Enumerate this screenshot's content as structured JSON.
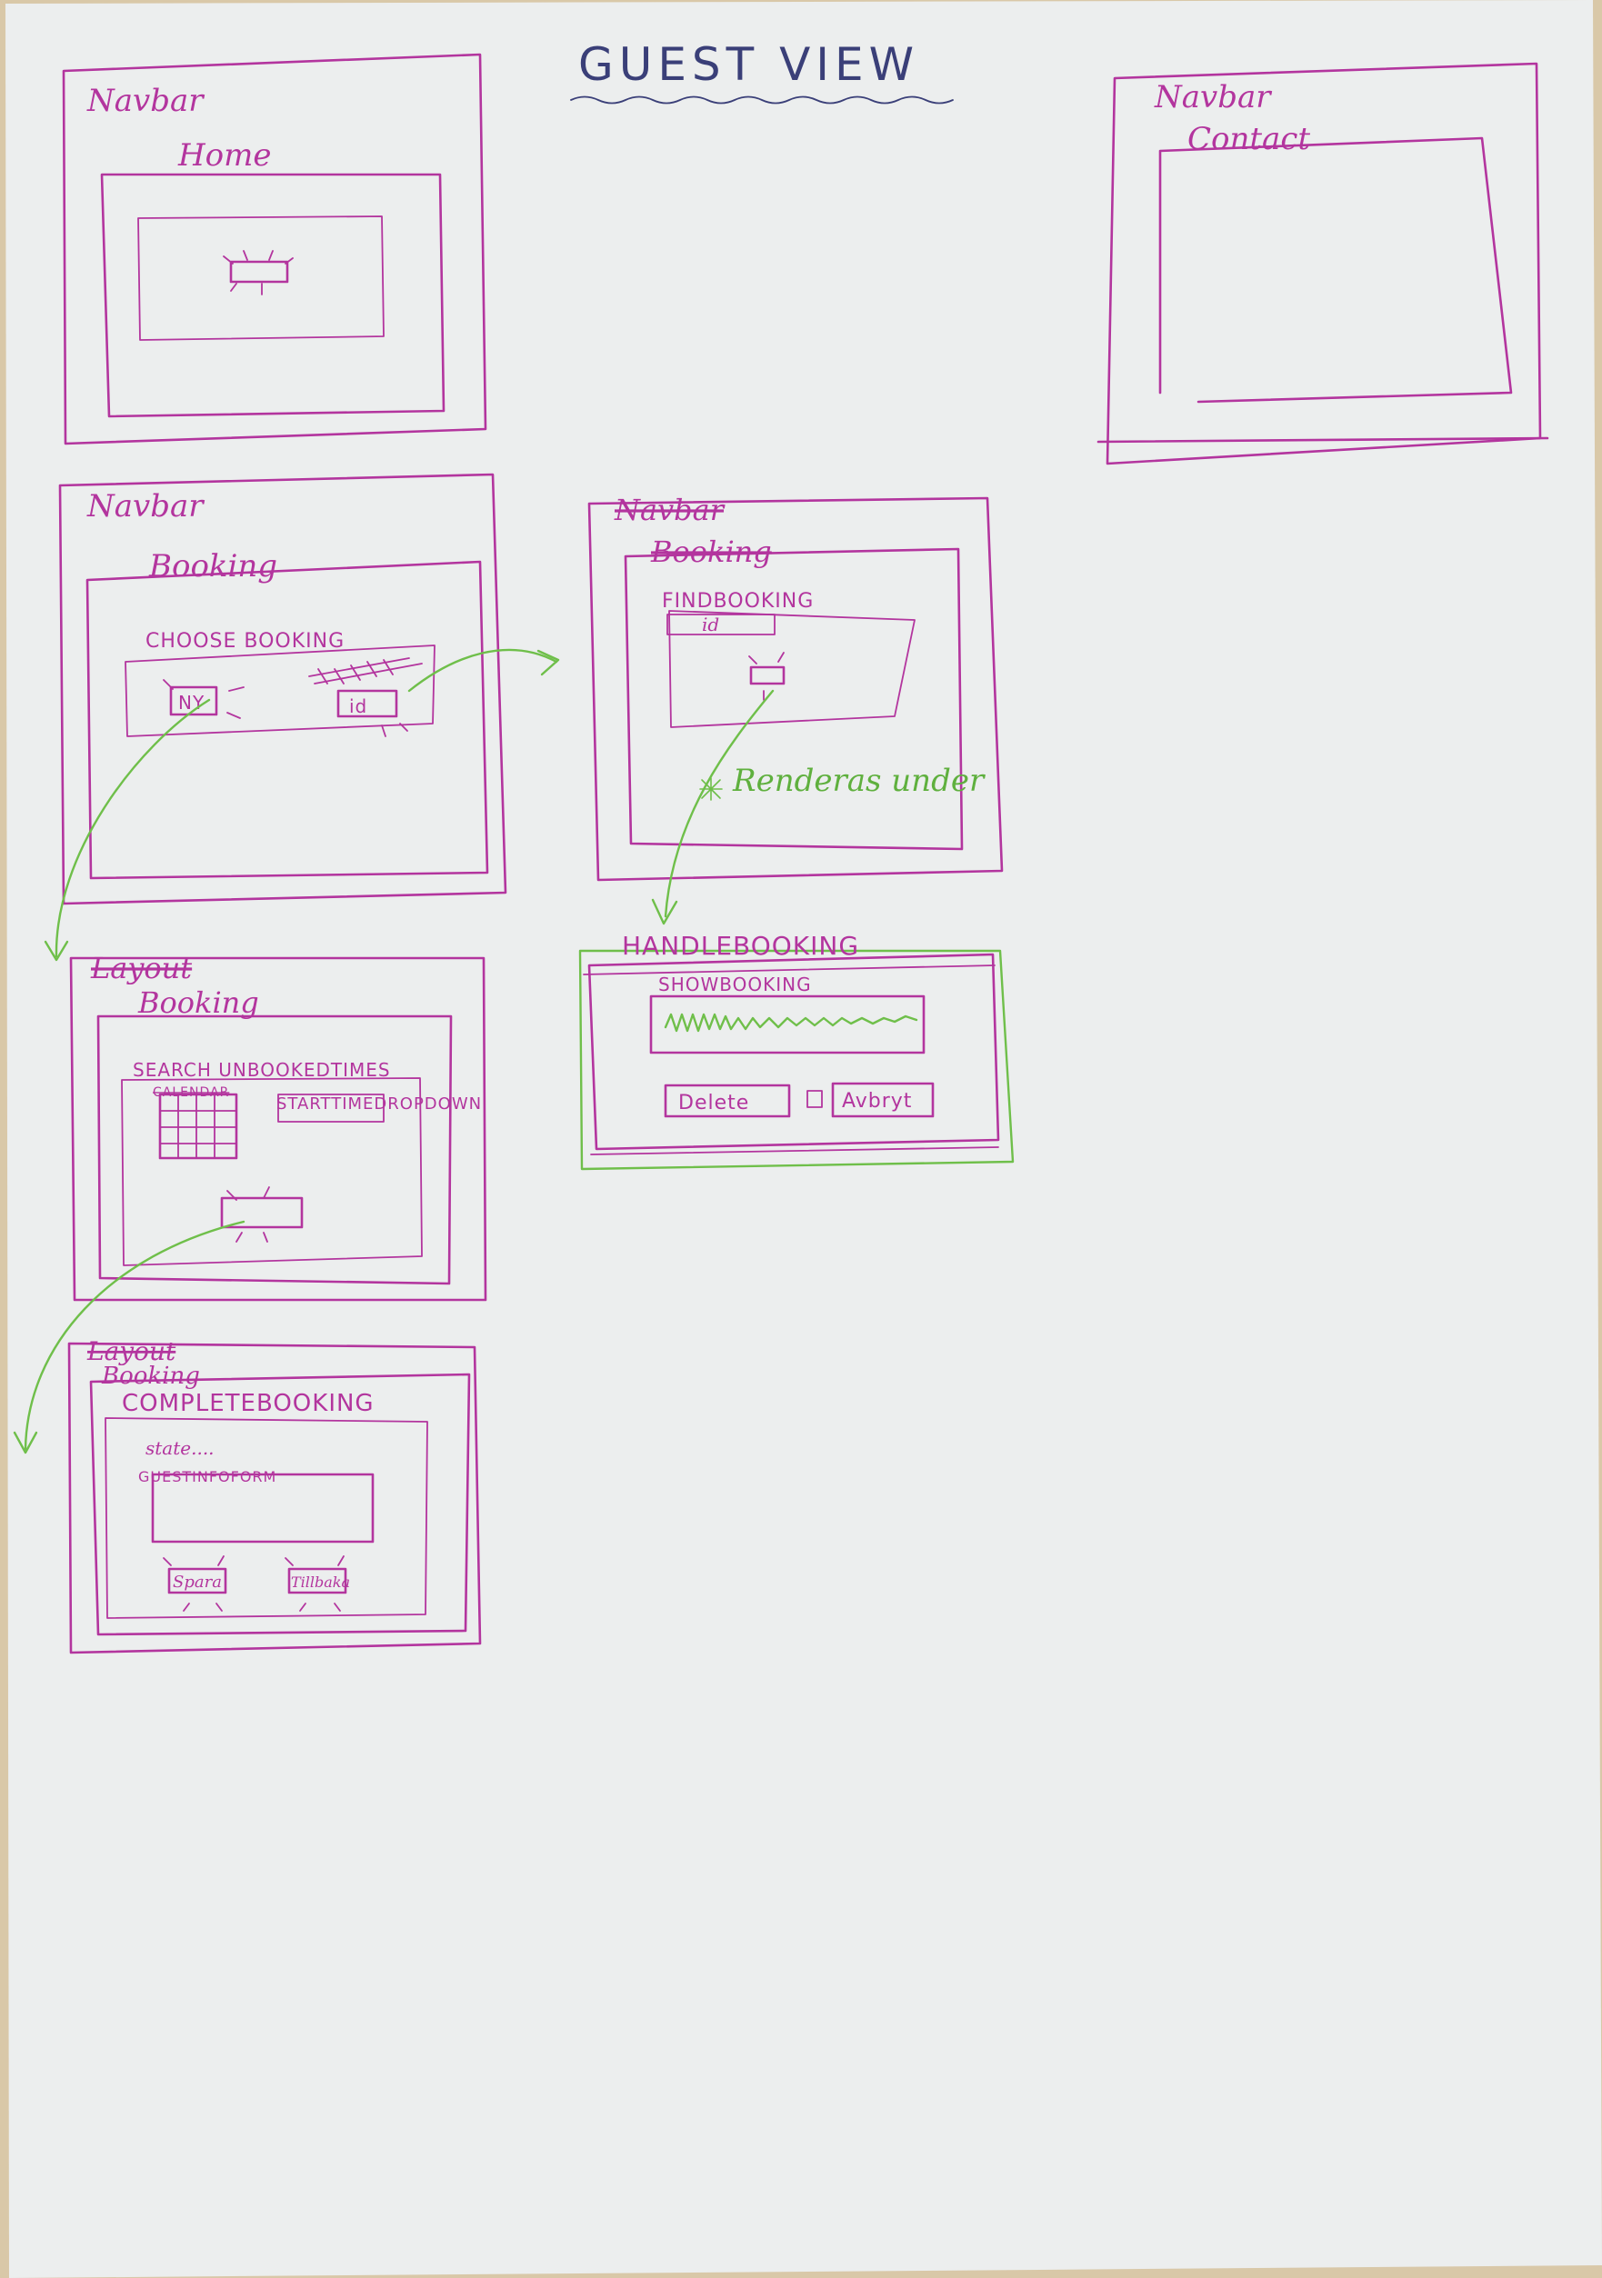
{
  "title": "GUEST VIEW",
  "home_panel": {
    "navbar": "Navbar",
    "page": "Home"
  },
  "contact_panel": {
    "navbar": "Navbar",
    "page": "Contact"
  },
  "booking_panel": {
    "navbar": "Navbar",
    "page": "Booking",
    "choose_label": "CHOOSE BOOKING",
    "new_button": "NY",
    "id_button": "id"
  },
  "find_panel": {
    "navbar": "Navbar",
    "page": "Booking",
    "find_label": "FINDBOOKING",
    "id_input": "id",
    "note": "Renderas under"
  },
  "handle_panel": {
    "title": "HANDLEBOOKING",
    "show_label": "SHOWBOOKING",
    "delete_button": "Delete",
    "cancel_button": "Avbryt"
  },
  "search_panel": {
    "layout": "Layout",
    "page": "Booking",
    "search_label": "SEARCH UNBOOKEDTIMES",
    "calendar_label": "CALENDAR",
    "dropdown_label": "STARTTIMEDROPDOWN"
  },
  "complete_panel": {
    "layout": "Layout",
    "page": "Booking",
    "complete_label": "COMPLETEBOOKING",
    "state_label": "state....",
    "form_label": "GUESTINFOFORM",
    "save_button": "Spara",
    "back_button": "Tillbaka"
  },
  "colors": {
    "pen": "#b3359e",
    "green": "#6fbf4a",
    "title_ink": "#3a3f78",
    "paper": "#eceeee"
  }
}
